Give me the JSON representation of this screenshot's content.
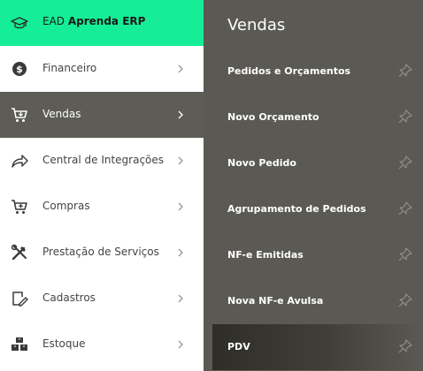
{
  "brand": {
    "prefix": "EAD",
    "name": "Aprenda ERP"
  },
  "sidebar": {
    "items": [
      {
        "label": "Financeiro"
      },
      {
        "label": "Vendas"
      },
      {
        "label": "Central de Integrações"
      },
      {
        "label": "Compras"
      },
      {
        "label": "Prestação de Serviços"
      },
      {
        "label": "Cadastros"
      },
      {
        "label": "Estoque"
      }
    ]
  },
  "submenu": {
    "title": "Vendas",
    "items": [
      {
        "label": "Pedidos e Orçamentos"
      },
      {
        "label": "Novo Orçamento"
      },
      {
        "label": "Novo Pedido"
      },
      {
        "label": "Agrupamento de Pedidos"
      },
      {
        "label": "NF-e Emitidas"
      },
      {
        "label": "Nova NF-e Avulsa"
      },
      {
        "label": "PDV"
      }
    ]
  },
  "colors": {
    "brand_accent": "#15ee96",
    "active_nav_bg": "#5d5c55",
    "submenu_bg": "#5a5953",
    "nav_text": "#444444"
  },
  "icons": {
    "brand": "graduation-cap-icon",
    "sidebar": [
      "dollar-coin-icon",
      "cart-icon",
      "share-arrow-icon",
      "cart-add-icon",
      "tools-icon",
      "edit-document-icon",
      "boxes-icon"
    ],
    "chevron": "chevron-right-icon",
    "pin": "pin-icon"
  }
}
